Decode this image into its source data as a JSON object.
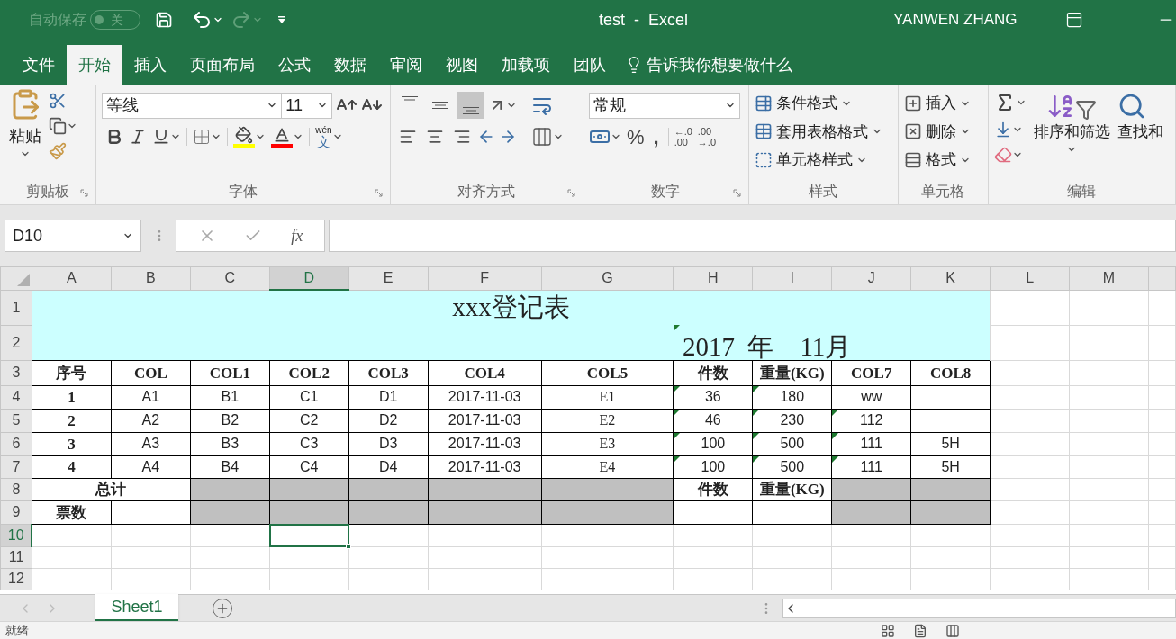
{
  "title_bar": {
    "autosave_label": "自动保存",
    "autosave_state": "关",
    "autosave_on": false,
    "title": "test  -  Excel",
    "user": "YANWEN ZHANG"
  },
  "ribbon_tabs": [
    {
      "label": "文件",
      "selected": false
    },
    {
      "label": "开始",
      "selected": true
    },
    {
      "label": "插入",
      "selected": false
    },
    {
      "label": "页面布局",
      "selected": false
    },
    {
      "label": "公式",
      "selected": false
    },
    {
      "label": "数据",
      "selected": false
    },
    {
      "label": "审阅",
      "selected": false
    },
    {
      "label": "视图",
      "selected": false
    },
    {
      "label": "加载项",
      "selected": false
    },
    {
      "label": "团队",
      "selected": false
    }
  ],
  "tell_me": "告诉我你想要做什么",
  "clipboard": {
    "paste": "粘贴",
    "group": "剪贴板"
  },
  "font": {
    "name": "等线",
    "size": "11",
    "phonetic_top": "wén",
    "phonetic_bottom": "文",
    "group": "字体"
  },
  "alignment": {
    "vertical": [
      {
        "kind": "top",
        "selected": false
      },
      {
        "kind": "middle",
        "selected": false
      },
      {
        "kind": "bottom",
        "selected": true
      }
    ],
    "horizontal": [
      {
        "kind": "left",
        "selected": false
      },
      {
        "kind": "center",
        "selected": false
      },
      {
        "kind": "right",
        "selected": false
      }
    ],
    "group": "对齐方式"
  },
  "number": {
    "format": "常规",
    "percent": "%",
    "comma": ",",
    "increase_decimal": [
      "←.0",
      ".00"
    ],
    "decrease_decimal": [
      ".00",
      "→.0"
    ],
    "group": "数字"
  },
  "styles": {
    "items": [
      "条件格式",
      "套用表格格式",
      "单元格样式"
    ],
    "group": "样式"
  },
  "cells_group": {
    "items": [
      "插入",
      "删除",
      "格式"
    ],
    "group": "单元格"
  },
  "editing": {
    "sort": "排序和筛选",
    "find": "查找和",
    "group": "编辑"
  },
  "formula_bar": {
    "name_box": "D10",
    "fx": "fx"
  },
  "sheet": {
    "columns": [
      {
        "label": "A",
        "selected": false
      },
      {
        "label": "B",
        "selected": false
      },
      {
        "label": "C",
        "selected": false
      },
      {
        "label": "D",
        "selected": true
      },
      {
        "label": "E",
        "selected": false
      },
      {
        "label": "F",
        "selected": false
      },
      {
        "label": "G",
        "selected": false
      },
      {
        "label": "H",
        "selected": false
      },
      {
        "label": "I",
        "selected": false
      },
      {
        "label": "J",
        "selected": false
      },
      {
        "label": "K",
        "selected": false
      },
      {
        "label": "L",
        "selected": false
      },
      {
        "label": "M",
        "selected": false
      }
    ],
    "row_numbers": [
      {
        "label": "1",
        "selected": false
      },
      {
        "label": "2",
        "selected": false
      },
      {
        "label": "3",
        "selected": false
      },
      {
        "label": "4",
        "selected": false
      },
      {
        "label": "5",
        "selected": false
      },
      {
        "label": "6",
        "selected": false
      },
      {
        "label": "7",
        "selected": false
      },
      {
        "label": "8",
        "selected": false
      },
      {
        "label": "9",
        "selected": false
      },
      {
        "label": "10",
        "selected": true
      },
      {
        "label": "11",
        "selected": false
      },
      {
        "label": "12",
        "selected": false
      }
    ],
    "title": "xxx登记表",
    "date": {
      "text": "2017  年    11月",
      "flag": true
    },
    "rows": [
      {
        "cells": [
          {
            "kind": "header",
            "text": "序号",
            "flag": false
          },
          {
            "kind": "header",
            "text": "COL",
            "flag": false
          },
          {
            "kind": "header",
            "text": "COL1",
            "flag": false
          },
          {
            "kind": "header",
            "text": "COL2",
            "flag": false
          },
          {
            "kind": "header",
            "text": "COL3",
            "flag": false
          },
          {
            "kind": "header",
            "text": "COL4",
            "flag": false
          },
          {
            "kind": "header",
            "text": "COL5",
            "flag": false
          },
          {
            "kind": "header",
            "text": "件数",
            "flag": false
          },
          {
            "kind": "header",
            "text": "重量(KG)",
            "flag": false
          },
          {
            "kind": "header",
            "text": "COL7",
            "flag": false
          },
          {
            "kind": "header",
            "text": "COL8",
            "flag": false
          }
        ]
      },
      {
        "cells": [
          {
            "kind": "header",
            "text": "1",
            "flag": false
          },
          {
            "kind": "value",
            "text": "A1",
            "flag": false
          },
          {
            "kind": "value",
            "text": "B1",
            "flag": false
          },
          {
            "kind": "value",
            "text": "C1",
            "flag": false
          },
          {
            "kind": "value",
            "text": "D1",
            "flag": false
          },
          {
            "kind": "value",
            "text": "2017-11-03",
            "flag": false
          },
          {
            "kind": "serif",
            "text": "E1",
            "flag": false
          },
          {
            "kind": "value",
            "text": "36",
            "flag": true
          },
          {
            "kind": "value",
            "text": "180",
            "flag": true
          },
          {
            "kind": "value",
            "text": "ww",
            "flag": false
          },
          {
            "kind": "blank",
            "flag": false
          }
        ]
      },
      {
        "cells": [
          {
            "kind": "header",
            "text": "2",
            "flag": false
          },
          {
            "kind": "value",
            "text": "A2",
            "flag": false
          },
          {
            "kind": "value",
            "text": "B2",
            "flag": false
          },
          {
            "kind": "value",
            "text": "C2",
            "flag": false
          },
          {
            "kind": "value",
            "text": "D2",
            "flag": false
          },
          {
            "kind": "value",
            "text": "2017-11-03",
            "flag": false
          },
          {
            "kind": "serif",
            "text": "E2",
            "flag": false
          },
          {
            "kind": "value",
            "text": "46",
            "flag": true
          },
          {
            "kind": "value",
            "text": "230",
            "flag": true
          },
          {
            "kind": "value",
            "text": "112",
            "flag": true
          },
          {
            "kind": "blank",
            "flag": false
          }
        ]
      },
      {
        "cells": [
          {
            "kind": "header",
            "text": "3",
            "flag": false
          },
          {
            "kind": "value",
            "text": "A3",
            "flag": false
          },
          {
            "kind": "value",
            "text": "B3",
            "flag": false
          },
          {
            "kind": "value",
            "text": "C3",
            "flag": false
          },
          {
            "kind": "value",
            "text": "D3",
            "flag": false
          },
          {
            "kind": "value",
            "text": "2017-11-03",
            "flag": false
          },
          {
            "kind": "serif",
            "text": "E3",
            "flag": false
          },
          {
            "kind": "value",
            "text": "100",
            "flag": true
          },
          {
            "kind": "value",
            "text": "500",
            "flag": true
          },
          {
            "kind": "value",
            "text": "111",
            "flag": true
          },
          {
            "kind": "value",
            "text": "5H",
            "flag": false
          }
        ]
      },
      {
        "cells": [
          {
            "kind": "header",
            "text": "4",
            "flag": false
          },
          {
            "kind": "value",
            "text": "A4",
            "flag": false
          },
          {
            "kind": "value",
            "text": "B4",
            "flag": false
          },
          {
            "kind": "value",
            "text": "C4",
            "flag": false
          },
          {
            "kind": "value",
            "text": "D4",
            "flag": false
          },
          {
            "kind": "value",
            "text": "2017-11-03",
            "flag": false
          },
          {
            "kind": "serif",
            "text": "E4",
            "flag": false
          },
          {
            "kind": "value",
            "text": "100",
            "flag": true
          },
          {
            "kind": "value",
            "text": "500",
            "flag": true
          },
          {
            "kind": "value",
            "text": "111",
            "flag": true
          },
          {
            "kind": "value",
            "text": "5H",
            "flag": false
          }
        ]
      },
      {
        "cells": [
          {
            "kind": "header",
            "text": "总计",
            "colspan": 2,
            "flag": false
          },
          {
            "kind": "shaded",
            "flag": false
          },
          {
            "kind": "shaded",
            "flag": false
          },
          {
            "kind": "shaded",
            "flag": false
          },
          {
            "kind": "shaded",
            "flag": false
          },
          {
            "kind": "shaded",
            "flag": false
          },
          {
            "kind": "header",
            "text": "件数",
            "flag": false
          },
          {
            "kind": "header",
            "text": "重量(KG)",
            "flag": false
          },
          {
            "kind": "shaded",
            "flag": false
          },
          {
            "kind": "shaded",
            "flag": false
          }
        ]
      },
      {
        "cells": [
          {
            "kind": "header",
            "text": "票数",
            "flag": false
          },
          {
            "kind": "blank",
            "flag": false
          },
          {
            "kind": "shaded",
            "flag": false
          },
          {
            "kind": "shaded",
            "flag": false
          },
          {
            "kind": "shaded",
            "flag": false
          },
          {
            "kind": "shaded",
            "flag": false
          },
          {
            "kind": "shaded",
            "flag": false
          },
          {
            "kind": "blank",
            "flag": false
          },
          {
            "kind": "blank",
            "flag": false
          },
          {
            "kind": "shaded",
            "flag": false
          },
          {
            "kind": "shaded",
            "flag": false
          }
        ]
      }
    ]
  },
  "sheet_tabs": [
    {
      "label": "Sheet1",
      "selected": true
    }
  ],
  "status_bar": {
    "text": "就绪"
  }
}
